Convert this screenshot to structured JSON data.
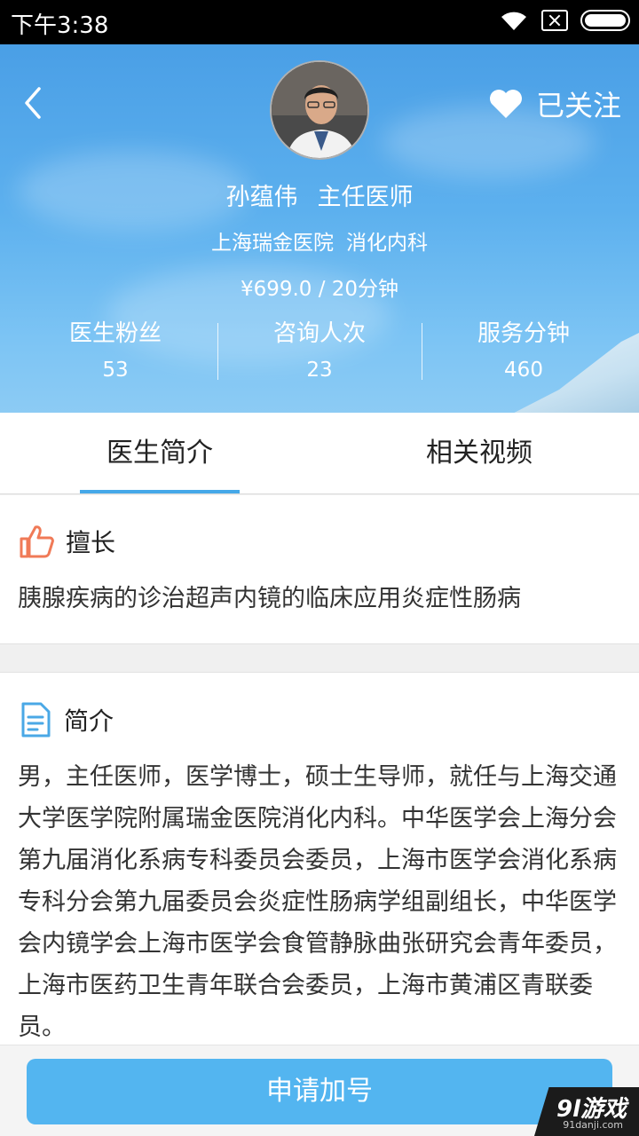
{
  "status_bar": {
    "time": "下午3:38"
  },
  "header": {
    "follow_label": "已关注",
    "doctor_name": "孙蕴伟",
    "doctor_title": "主任医师",
    "hospital": "上海瑞金医院",
    "department": "消化内科",
    "price": "¥699.0 / 20分钟",
    "stats": [
      {
        "label": "医生粉丝",
        "value": "53"
      },
      {
        "label": "咨询人次",
        "value": "23"
      },
      {
        "label": "服务分钟",
        "value": "460"
      }
    ]
  },
  "tabs": [
    {
      "label": "医生简介",
      "active": true
    },
    {
      "label": "相关视频",
      "active": false
    }
  ],
  "expertise": {
    "title": "擅长",
    "text": "胰腺疾病的诊治超声内镜的临床应用炎症性肠病"
  },
  "intro": {
    "title": "简介",
    "text": "男，主任医师，医学博士，硕士生导师，就任与上海交通大学医学院附属瑞金医院消化内科。中华医学会上海分会 第九届消化系病专科委员会委员，上海市医学会消化系病专科分会第九届委员会炎症性肠病学组副组长，中华医学会内镜学会上海市医学会食管静脉曲张研究会青年委员，上海市医药卫生青年联合会委员，上海市黄浦区青联委员。"
  },
  "bottom": {
    "apply_label": "申请加号"
  },
  "watermark": {
    "main": "9l游戏",
    "sub": "91danji.com"
  },
  "colors": {
    "accent": "#45a8e8",
    "button": "#53b5f0",
    "header_top": "#4a9fe6",
    "thumb_icon": "#f07a57",
    "doc_icon": "#4aa8e6"
  }
}
